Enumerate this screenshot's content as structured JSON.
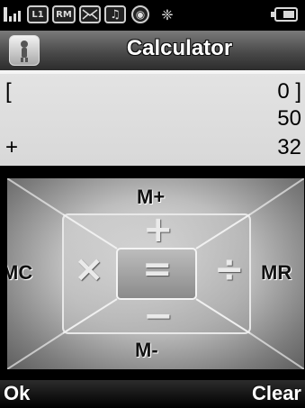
{
  "statusbar": {
    "icons": [
      {
        "name": "signal-icon"
      },
      {
        "name": "l1-icon",
        "label": "L1"
      },
      {
        "name": "rm-icon",
        "label": "RM"
      },
      {
        "name": "message-icon"
      },
      {
        "name": "music-icon"
      },
      {
        "name": "globe-icon"
      },
      {
        "name": "settings-icon"
      },
      {
        "name": "battery-icon"
      }
    ]
  },
  "titlebar": {
    "title": "Calculator"
  },
  "display": {
    "lines": [
      {
        "operator": "[",
        "value": "0 ]"
      },
      {
        "operator": "",
        "value": "50"
      },
      {
        "operator": "+",
        "value": "32"
      }
    ]
  },
  "keypad": {
    "memory_add": "M+",
    "memory_subtract": "M-",
    "memory_clear": "MC",
    "memory_recall": "MR",
    "add": "+",
    "subtract": "−",
    "multiply": "×",
    "divide": "÷",
    "equals": "="
  },
  "softkeys": {
    "left": "Ok",
    "right": "Clear"
  }
}
